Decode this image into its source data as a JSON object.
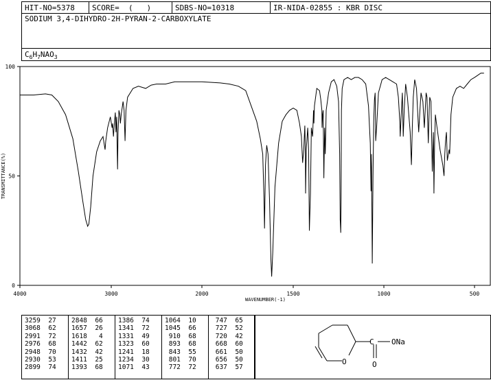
{
  "header": {
    "hit_no": "HIT-NO=5378",
    "score": "SCORE=  (   )",
    "sdbs_no": "SDBS-NO=10318",
    "ir_code": "IR-NIDA-02855 : KBR DISC"
  },
  "compound_name": "SODIUM 3,4-DIHYDRO-2H-PYRAN-2-CARBOXYLATE",
  "formula": {
    "parts": [
      "C",
      "6",
      "H",
      "7",
      "NAO",
      "3"
    ]
  },
  "chart_data": {
    "type": "line",
    "xlabel": "WAVENUMBER(-1)",
    "ylabel": "TRANSMITTANCE(%)",
    "xlim": [
      4000,
      400
    ],
    "ylim": [
      0,
      100
    ],
    "x_ticks": [
      4000,
      3000,
      2000,
      1500,
      1000,
      500
    ],
    "x_tick_labels": [
      "4000",
      "3000",
      "2000",
      "1500",
      "1000",
      "500"
    ],
    "y_ticks": [
      0,
      50,
      100
    ],
    "y_tick_labels": [
      "0",
      "50",
      "100"
    ],
    "x": [
      4000,
      3850,
      3720,
      3650,
      3580,
      3500,
      3420,
      3360,
      3310,
      3280,
      3265,
      3259,
      3245,
      3225,
      3200,
      3160,
      3120,
      3090,
      3075,
      3068,
      3060,
      3040,
      3010,
      2991,
      2985,
      2976,
      2965,
      2955,
      2948,
      2940,
      2933,
      2930,
      2925,
      2915,
      2905,
      2899,
      2890,
      2870,
      2858,
      2848,
      2838,
      2820,
      2760,
      2700,
      2620,
      2560,
      2500,
      2400,
      2300,
      2200,
      2100,
      2000,
      1900,
      1850,
      1800,
      1760,
      1730,
      1700,
      1680,
      1667,
      1660,
      1657,
      1652,
      1645,
      1638,
      1630,
      1622,
      1618,
      1612,
      1600,
      1580,
      1560,
      1540,
      1520,
      1500,
      1480,
      1465,
      1455,
      1448,
      1442,
      1436,
      1433,
      1432,
      1428,
      1420,
      1415,
      1411,
      1405,
      1400,
      1393,
      1388,
      1386,
      1383,
      1370,
      1355,
      1348,
      1342,
      1341,
      1338,
      1335,
      1331,
      1327,
      1323,
      1318,
      1305,
      1290,
      1275,
      1260,
      1250,
      1244,
      1241,
      1238,
      1236,
      1234,
      1230,
      1220,
      1200,
      1180,
      1160,
      1140,
      1120,
      1100,
      1085,
      1075,
      1071,
      1068,
      1064,
      1060,
      1056,
      1052,
      1048,
      1045,
      1040,
      1030,
      1010,
      990,
      970,
      950,
      930,
      920,
      912,
      910,
      906,
      898,
      893,
      888,
      880,
      870,
      855,
      848,
      843,
      838,
      830,
      820,
      808,
      801,
      795,
      785,
      777,
      772,
      767,
      762,
      755,
      750,
      747,
      740,
      733,
      727,
      724,
      720,
      716,
      710,
      700,
      690,
      675,
      668,
      664,
      660,
      655,
      650,
      640,
      637,
      630,
      620,
      600,
      580,
      560,
      540,
      520,
      500,
      480,
      460,
      440,
      420,
      400
    ],
    "y": [
      87,
      87,
      87.5,
      87,
      84,
      78,
      67,
      52,
      38,
      30,
      28,
      27,
      28,
      36,
      50,
      61,
      66,
      68,
      64,
      62,
      66,
      72,
      77,
      72,
      74,
      68,
      74,
      79,
      70,
      77,
      60,
      53,
      70,
      80,
      78,
      74,
      78,
      84,
      80,
      66,
      80,
      86,
      90,
      91,
      90,
      91.5,
      92,
      92,
      93,
      93,
      93,
      93,
      92.5,
      92,
      91,
      89,
      82,
      75,
      67,
      60,
      40,
      26,
      55,
      64,
      60,
      40,
      12,
      4,
      15,
      45,
      65,
      75,
      78,
      80,
      81,
      80,
      74,
      68,
      56,
      62,
      73,
      60,
      42,
      62,
      72,
      62,
      25,
      42,
      72,
      68,
      80,
      74,
      82,
      90,
      89,
      85,
      80,
      72,
      78,
      80,
      49,
      72,
      60,
      80,
      88,
      93,
      94,
      91,
      84,
      60,
      30,
      24,
      40,
      80,
      90,
      94,
      95,
      94,
      95,
      95,
      94,
      92,
      82,
      65,
      43,
      60,
      10,
      50,
      75,
      85,
      88,
      66,
      72,
      88,
      94,
      95,
      94,
      93,
      92,
      86,
      75,
      68,
      75,
      88,
      68,
      80,
      92,
      86,
      70,
      55,
      72,
      86,
      94,
      90,
      70,
      80,
      88,
      84,
      72,
      80,
      88,
      86,
      65,
      80,
      86,
      84,
      52,
      70,
      42,
      65,
      78,
      74,
      68,
      62,
      55,
      50,
      60,
      66,
      70,
      57,
      62,
      60,
      78,
      86,
      90,
      91,
      90,
      92,
      94,
      95,
      96,
      97,
      97
    ]
  },
  "peaks": [
    [
      [
        "3259",
        "27"
      ],
      [
        "3068",
        "62"
      ],
      [
        "2991",
        "72"
      ],
      [
        "2976",
        "68"
      ],
      [
        "2948",
        "70"
      ],
      [
        "2930",
        "53"
      ],
      [
        "2899",
        "74"
      ]
    ],
    [
      [
        "2848",
        "66"
      ],
      [
        "1657",
        "26"
      ],
      [
        "1618",
        "4"
      ],
      [
        "1442",
        "62"
      ],
      [
        "1432",
        "42"
      ],
      [
        "1411",
        "25"
      ],
      [
        "1393",
        "68"
      ]
    ],
    [
      [
        "1386",
        "74"
      ],
      [
        "1341",
        "72"
      ],
      [
        "1331",
        "49"
      ],
      [
        "1323",
        "60"
      ],
      [
        "1241",
        "18"
      ],
      [
        "1234",
        "30"
      ],
      [
        "1071",
        "43"
      ]
    ],
    [
      [
        "1064",
        "10"
      ],
      [
        "1045",
        "66"
      ],
      [
        "910",
        "68"
      ],
      [
        "893",
        "68"
      ],
      [
        "843",
        "55"
      ],
      [
        "801",
        "70"
      ],
      [
        "772",
        "72"
      ]
    ],
    [
      [
        "747",
        "65"
      ],
      [
        "727",
        "52"
      ],
      [
        "720",
        "42"
      ],
      [
        "668",
        "60"
      ],
      [
        "661",
        "50"
      ],
      [
        "656",
        "50"
      ],
      [
        "637",
        "57"
      ]
    ]
  ],
  "structure": {
    "ring_oxygen": "O",
    "carbonyl_oxygen": "O",
    "salt_group": "ONa"
  }
}
